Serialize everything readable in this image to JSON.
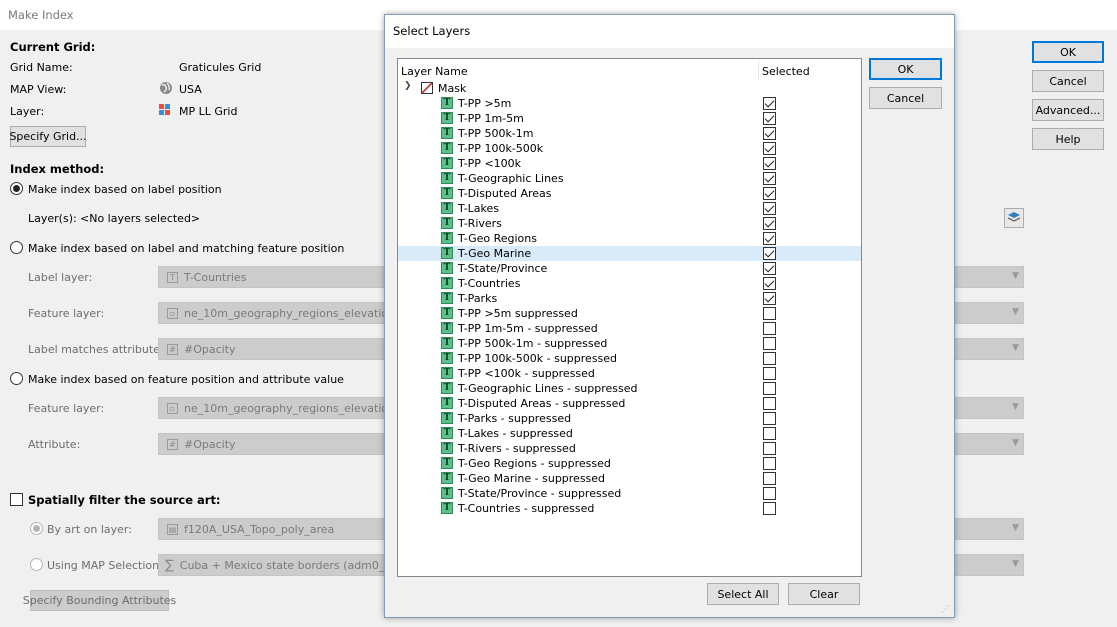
{
  "window": {
    "title": "Make Index"
  },
  "current_grid": {
    "heading": "Current Grid:",
    "grid_name_label": "Grid Name:",
    "grid_name_value": "Graticules Grid",
    "map_view_label": "MAP View:",
    "map_view_value": "USA",
    "layer_label": "Layer:",
    "layer_value": "MP LL Grid",
    "specify_grid_button": "Specify Grid..."
  },
  "index_method": {
    "heading": "Index method:",
    "option1_label": "Make index based on label position",
    "layers_label": "Layer(s):",
    "layers_value": "<No layers selected>",
    "option2_label": "Make index based on label and matching feature position",
    "label_layer_label": "Label layer:",
    "label_layer_value": "T-Countries",
    "feature_layer_label": "Feature layer:",
    "feature_layer_value": "ne_10m_geography_regions_elevation_po",
    "label_matches_label": "Label matches attribute:",
    "label_matches_value": "#Opacity",
    "option3_label": "Make index based on feature position and attribute value",
    "feature_layer2_label": "Feature layer:",
    "feature_layer2_value": "ne_10m_geography_regions_elevation_po",
    "attribute_label": "Attribute:",
    "attribute_value": "#Opacity"
  },
  "spatial_filter": {
    "heading": "Spatially filter the source art:",
    "by_art_label": "By art on layer:",
    "by_art_value": "f120A_USA_Topo_poly_area",
    "map_selection_label": "Using MAP Selection:",
    "map_selection_value": "Cuba + Mexico state borders (adm0_name",
    "bounding_button": "Specify Bounding Attributes"
  },
  "main_buttons": {
    "ok": "OK",
    "cancel": "Cancel",
    "advanced": "Advanced...",
    "help": "Help"
  },
  "dialog": {
    "title": "Select Layers",
    "col_layer_name": "Layer Name",
    "col_selected": "Selected",
    "parent_layer": "Mask",
    "ok": "OK",
    "cancel": "Cancel",
    "select_all": "Select All",
    "clear": "Clear",
    "layers": [
      {
        "name": "T-PP >5m",
        "checked": true
      },
      {
        "name": "T-PP 1m-5m",
        "checked": true
      },
      {
        "name": "T-PP 500k-1m",
        "checked": true
      },
      {
        "name": "T-PP 100k-500k",
        "checked": true
      },
      {
        "name": "T-PP <100k",
        "checked": true
      },
      {
        "name": "T-Geographic Lines",
        "checked": true
      },
      {
        "name": "T-Disputed Areas",
        "checked": true
      },
      {
        "name": "T-Lakes",
        "checked": true
      },
      {
        "name": "T-Rivers",
        "checked": true
      },
      {
        "name": "T-Geo Regions",
        "checked": true
      },
      {
        "name": "T-Geo Marine",
        "checked": true,
        "highlighted": true
      },
      {
        "name": "T-State/Province",
        "checked": true
      },
      {
        "name": "T-Countries",
        "checked": true
      },
      {
        "name": "T-Parks",
        "checked": true
      },
      {
        "name": "T-PP >5m suppressed",
        "checked": false
      },
      {
        "name": "T-PP 1m-5m - suppressed",
        "checked": false
      },
      {
        "name": "T-PP 500k-1m - suppressed",
        "checked": false
      },
      {
        "name": "T-PP 100k-500k - suppressed",
        "checked": false
      },
      {
        "name": "T-PP <100k - suppressed",
        "checked": false
      },
      {
        "name": "T-Geographic Lines - suppressed",
        "checked": false
      },
      {
        "name": "T-Disputed Areas - suppressed",
        "checked": false
      },
      {
        "name": "T-Parks - suppressed",
        "checked": false
      },
      {
        "name": "T-Lakes - suppressed",
        "checked": false
      },
      {
        "name": "T-Rivers - suppressed",
        "checked": false
      },
      {
        "name": "T-Geo Regions - suppressed",
        "checked": false
      },
      {
        "name": "T-Geo Marine - suppressed",
        "checked": false
      },
      {
        "name": "T-State/Province - suppressed",
        "checked": false
      },
      {
        "name": "T-Countries - suppressed",
        "checked": false
      }
    ]
  },
  "icons": {
    "globe": "globe-icon",
    "grid_layer": "grid-layer-icon",
    "text_layer": "text-layer-icon",
    "mask": "mask-icon"
  },
  "colors": {
    "accent": "#0078d7",
    "selection": "#d9ebf9",
    "text_layer_icon": "#5cc08a"
  }
}
